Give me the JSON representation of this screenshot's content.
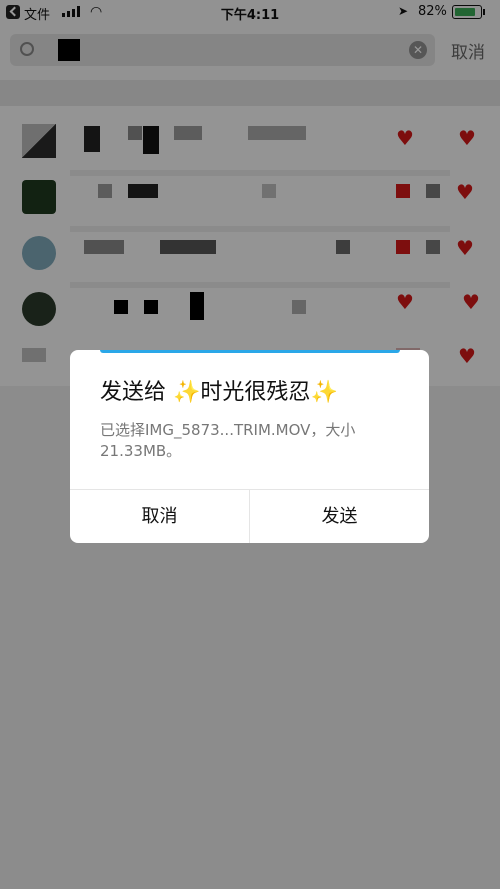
{
  "status_bar": {
    "carrier": "文件",
    "time": "下午4:11",
    "battery_percent": "82%",
    "battery_level": 0.82
  },
  "search": {
    "cancel_label": "取消"
  },
  "dialog": {
    "title_prefix": "发送给",
    "sparkle_left": "✨",
    "contact_name": "时光很残忍",
    "sparkle_right": "✨",
    "description": "已选择IMG_5873...TRIM.MOV，大小21.33MB。",
    "cancel_label": "取消",
    "send_label": "发送"
  },
  "colors": {
    "accent_blue": "#2aa7e8",
    "heart_red": "#d01818",
    "battery_green": "#3aa856"
  }
}
